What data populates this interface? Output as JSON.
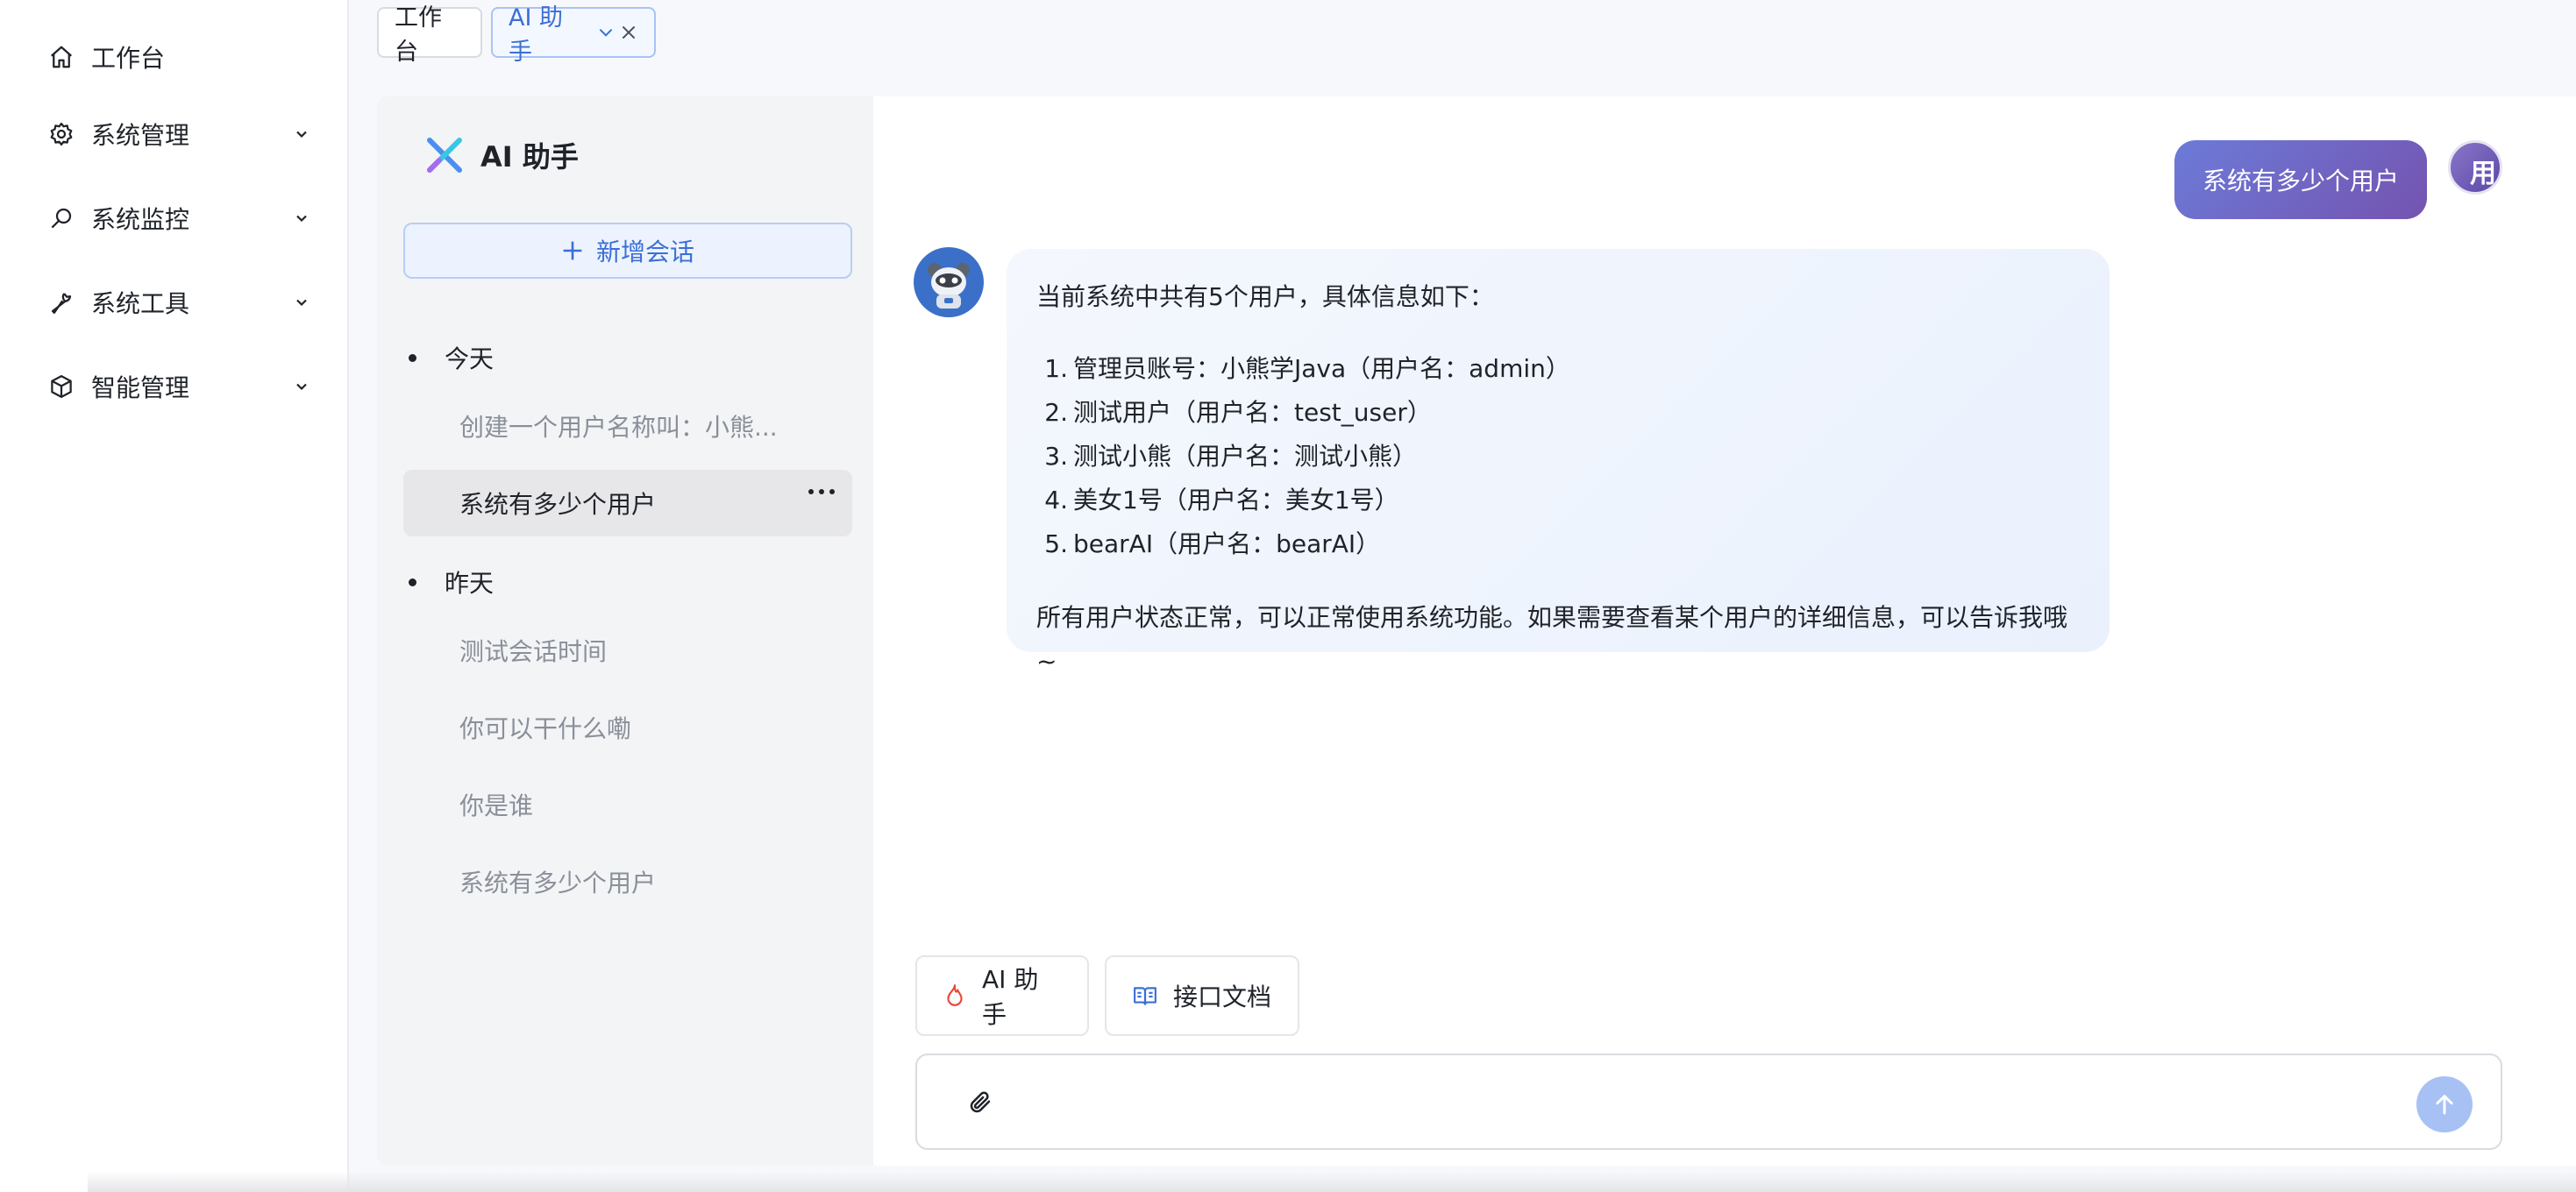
{
  "nav": {
    "items": [
      {
        "label": "工作台",
        "icon": "home-icon",
        "expandable": false
      },
      {
        "label": "系统管理",
        "icon": "gear-icon",
        "expandable": true
      },
      {
        "label": "系统监控",
        "icon": "monitor-icon",
        "expandable": true
      },
      {
        "label": "系统工具",
        "icon": "wrench-icon",
        "expandable": true
      },
      {
        "label": "智能管理",
        "icon": "cube-icon",
        "expandable": true
      }
    ]
  },
  "tabs": {
    "home": "工作台",
    "ai": "AI 助手"
  },
  "sessions": {
    "title": "AI 助手",
    "new_label": "新增会话",
    "groups": [
      {
        "label": "今天",
        "items": [
          "创建一个用户名称叫：小熊...",
          "系统有多少个用户"
        ]
      },
      {
        "label": "昨天",
        "items": [
          "测试会话时间",
          "你可以干什么嘞",
          "你是谁",
          "系统有多少个用户"
        ]
      }
    ],
    "active": "系统有多少个用户"
  },
  "chat": {
    "user_message": "系统有多少个用户",
    "user_avatar_text": "用",
    "bot_reply": {
      "intro": "当前系统中共有5个用户，具体信息如下：",
      "list": [
        "管理员账号：小熊学Java（用户名：admin）",
        "测试用户（用户名：test_user）",
        "测试小熊（用户名：测试小熊）",
        "美女1号（用户名：美女1号）",
        "bearAI（用户名：bearAI）"
      ],
      "outro": "所有用户状态正常，可以正常使用系统功能。如果需要查看某个用户的详细信息，可以告诉我哦~"
    },
    "shortcuts": [
      {
        "label": "AI 助手",
        "icon": "flame-icon"
      },
      {
        "label": "接口文档",
        "icon": "book-icon"
      }
    ],
    "input": {
      "value": "",
      "placeholder": ""
    }
  },
  "colors": {
    "accent": "#3b6fd6",
    "user_bubble": "#7553b0",
    "send_button": "#a7c1f4"
  }
}
